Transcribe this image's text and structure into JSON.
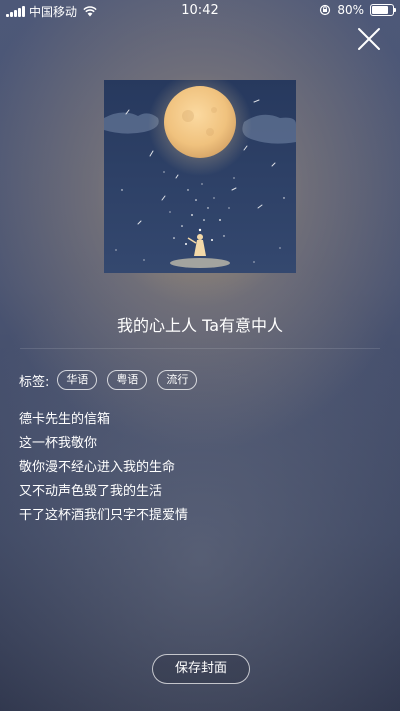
{
  "status_bar": {
    "carrier": "中国移动",
    "time": "10:42",
    "battery_percent": "80%",
    "battery_level": 0.8,
    "icons": [
      "signal-icon",
      "wifi-icon",
      "rotation-lock-icon",
      "battery-icon"
    ]
  },
  "song": {
    "title": "我的心上人 Ta有意中人"
  },
  "tags": {
    "label": "标签:",
    "items": [
      "华语",
      "粤语",
      "流行"
    ]
  },
  "lyrics": [
    "德卡先生的信箱",
    "这一杯我敬你",
    "敬你漫不经心进入我的生命",
    "又不动声色毁了我的生活",
    "干了这杯酒我们只字不提爱情"
  ],
  "actions": {
    "save_cover": "保存封面",
    "close_icon": "close-icon"
  },
  "colors": {
    "background_top": "#4d5878",
    "background_bottom": "#2e354c",
    "glow": "#c6aa78",
    "cover_sky": "#27395e",
    "moon": "#f0c27e"
  }
}
